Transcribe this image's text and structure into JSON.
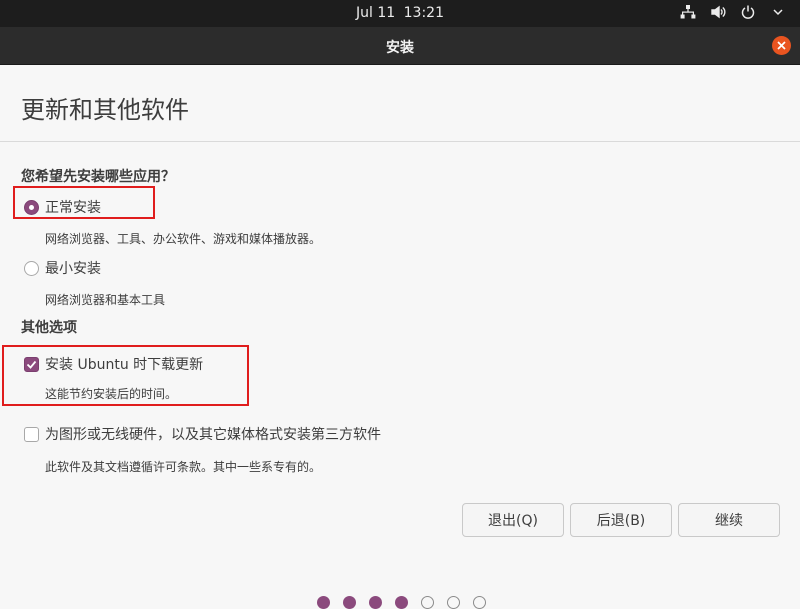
{
  "topbar": {
    "date": "Jul 11",
    "time": "13:21"
  },
  "window": {
    "title": "安装"
  },
  "page": {
    "title": "更新和其他软件"
  },
  "apps_section": {
    "heading": "您希望先安装哪些应用？",
    "normal": {
      "label": "正常安装",
      "description": "网络浏览器、工具、办公软件、游戏和媒体播放器。",
      "selected": true
    },
    "minimal": {
      "label": "最小安装",
      "description": "网络浏览器和基本工具",
      "selected": false
    }
  },
  "other_section": {
    "heading": "其他选项",
    "updates": {
      "label": "安装 Ubuntu 时下载更新",
      "description": "这能节约安装后的时间。",
      "checked": true
    },
    "third_party": {
      "label": "为图形或无线硬件，以及其它媒体格式安装第三方软件",
      "description": "此软件及其文档遵循许可条款。其中一些系专有的。",
      "checked": false
    }
  },
  "buttons": {
    "quit": "退出(Q)",
    "back": "后退(B)",
    "continue": "继续"
  },
  "progress": {
    "steps_total": 7,
    "steps_done": 4
  },
  "colors": {
    "accent": "#8b4a7d",
    "close": "#e95420",
    "highlight": "#e01d1d"
  }
}
